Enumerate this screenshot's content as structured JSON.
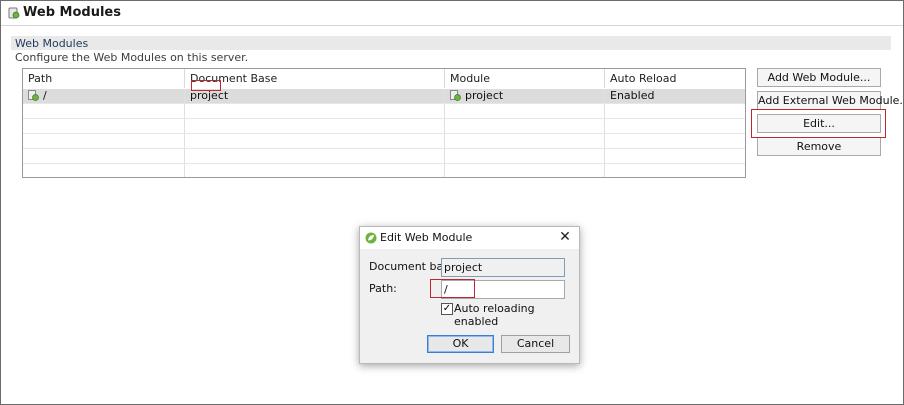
{
  "window": {
    "title": "Web Modules",
    "icon": "server-icon"
  },
  "section": {
    "title": "Web Modules",
    "description": "Configure the Web Modules on this server."
  },
  "table": {
    "columns": [
      "Path",
      "Document Base",
      "Module",
      "Auto Reload"
    ],
    "rows": [
      {
        "path": "/",
        "document_base": "project",
        "module": "project",
        "auto_reload": "Enabled",
        "selected": true
      }
    ]
  },
  "buttons": {
    "add_web_module": "Add Web Module...",
    "add_external_web_module": "Add External Web Module...",
    "edit": "Edit...",
    "remove": "Remove"
  },
  "dialog": {
    "title": "Edit Web Module",
    "icon": "spring-leaf-icon",
    "close_icon": "close-icon",
    "document_base_label": "Document base:",
    "document_base_value": "project",
    "path_label": "Path:",
    "path_value": "/",
    "auto_reload_label": "Auto reloading enabled",
    "auto_reload_checked": true,
    "ok_label": "OK",
    "cancel_label": "Cancel"
  },
  "colors": {
    "highlight": "#c0272d",
    "selected_row": "#dcdcdc",
    "section_bg": "#e9e9e9",
    "spring_green": "#6db33f"
  }
}
